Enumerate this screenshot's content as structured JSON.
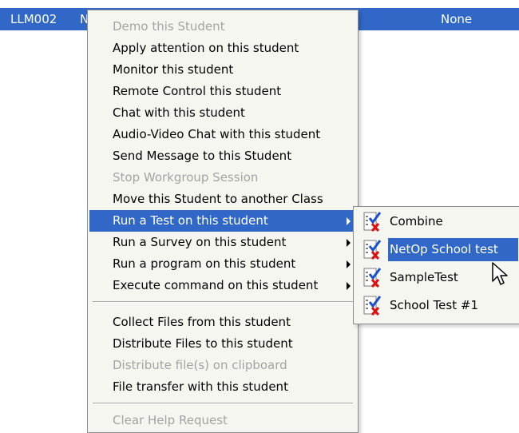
{
  "list_row": {
    "id": "LLM002",
    "fragment": "N",
    "status": "None"
  },
  "menu": {
    "items": [
      {
        "label": "Demo this Student",
        "disabled": true
      },
      {
        "label": "Apply attention on this student"
      },
      {
        "label": "Monitor this student"
      },
      {
        "label": "Remote Control this student"
      },
      {
        "label": "Chat with this student"
      },
      {
        "label": "Audio-Video Chat with this student"
      },
      {
        "label": "Send Message to this Student"
      },
      {
        "label": "Stop Workgroup Session",
        "disabled": true
      },
      {
        "label": "Move this Student to another Class"
      },
      {
        "label": "Run a Test on this student",
        "submenu": true,
        "selected": true
      },
      {
        "label": "Run a Survey on this student",
        "submenu": true
      },
      {
        "label": "Run a program on this student",
        "submenu": true
      },
      {
        "label": "Execute command on this student",
        "submenu": true
      },
      {
        "label": "Collect Files from this student"
      },
      {
        "label": "Distribute Files to this student"
      },
      {
        "label": "Distribute file(s) on clipboard",
        "disabled": true
      },
      {
        "label": "File transfer with this student"
      },
      {
        "label": "Clear Help Request",
        "disabled": true
      }
    ]
  },
  "submenu": {
    "items": [
      {
        "label": "Combine",
        "icon": "test-icon"
      },
      {
        "label": "NetOp School test",
        "icon": "test-icon",
        "highlight": true
      },
      {
        "label": "SampleTest",
        "icon": "test-icon"
      },
      {
        "label": "School Test #1",
        "icon": "test-icon"
      }
    ]
  },
  "colors": {
    "selection": "#3168c8",
    "menu_bg": "#f6f6f1",
    "disabled_text": "#a3a3a3"
  }
}
